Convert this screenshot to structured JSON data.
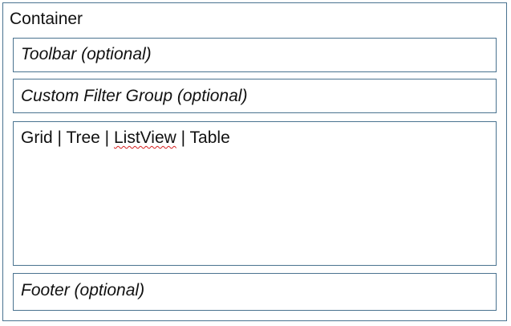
{
  "container": {
    "title": "Container"
  },
  "toolbar": {
    "label": "Toolbar (optional)"
  },
  "custom_filter_group": {
    "label": "Custom Filter Group (optional)"
  },
  "views": {
    "items": [
      "Grid",
      "Tree",
      "ListView",
      "Table"
    ],
    "separator": " | ",
    "spellcheck_flagged": "ListView"
  },
  "footer": {
    "label": "Footer (optional)"
  },
  "colors": {
    "border": "#4a7390",
    "spellcheck_underline": "#d62020"
  }
}
